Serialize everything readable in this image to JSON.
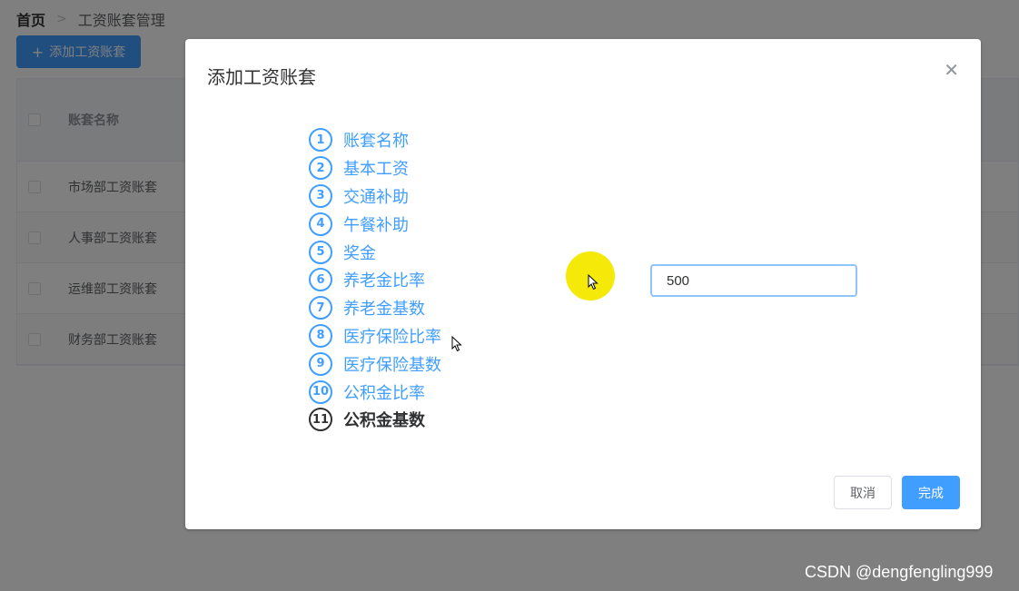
{
  "breadcrumb": {
    "home": "首页",
    "separator": ">",
    "current": "工资账套管理"
  },
  "toolbar": {
    "add_icon": "plus-icon",
    "add_label": "添加工资账套"
  },
  "table": {
    "header": {
      "name": "账套名称"
    },
    "rows": [
      {
        "name": "市场部工资账套"
      },
      {
        "name": "人事部工资账套"
      },
      {
        "name": "运维部工资账套"
      },
      {
        "name": "财务部工资账套"
      }
    ]
  },
  "dialog": {
    "title": "添加工资账套",
    "close_icon": "close-icon",
    "steps": [
      {
        "num": "1",
        "label": "账套名称"
      },
      {
        "num": "2",
        "label": "基本工资"
      },
      {
        "num": "3",
        "label": "交通补助"
      },
      {
        "num": "4",
        "label": "午餐补助"
      },
      {
        "num": "5",
        "label": "奖金"
      },
      {
        "num": "6",
        "label": "养老金比率"
      },
      {
        "num": "7",
        "label": "养老金基数"
      },
      {
        "num": "8",
        "label": "医疗保险比率"
      },
      {
        "num": "9",
        "label": "医疗保险基数"
      },
      {
        "num": "10",
        "label": "公积金比率"
      },
      {
        "num": "11",
        "label": "公积金基数"
      }
    ],
    "current_step": 11,
    "input": {
      "value": "500"
    },
    "cancel_label": "取消",
    "done_label": "完成"
  },
  "watermark": "CSDN @dengfengling999",
  "colors": {
    "primary": "#409eff",
    "highlight": "#f5e90a",
    "text_dark": "#303133",
    "overlay": "rgba(0,0,0,0.5)"
  }
}
